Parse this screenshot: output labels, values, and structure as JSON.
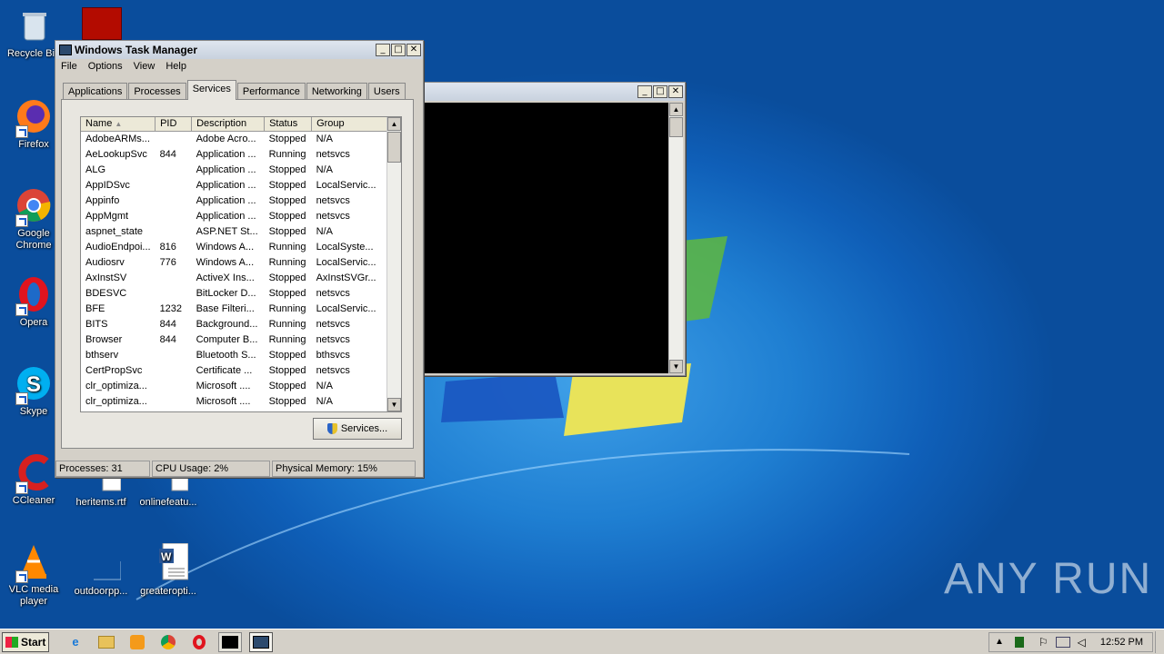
{
  "desktop": {
    "icons": [
      {
        "label": "Recycle Bin",
        "name": "recycle-bin-icon"
      },
      {
        "label": "Firefox",
        "name": "firefox-icon"
      },
      {
        "label": "Google Chrome",
        "name": "chrome-icon"
      },
      {
        "label": "Opera",
        "name": "opera-icon"
      },
      {
        "label": "Skype",
        "name": "skype-icon"
      },
      {
        "label": "CCleaner",
        "name": "ccleaner-icon"
      },
      {
        "label": "VLC media player",
        "name": "vlc-icon"
      },
      {
        "label": "heritems.rtf",
        "name": "rtf-file-icon"
      },
      {
        "label": "onlinefeatu...",
        "name": "file-icon"
      },
      {
        "label": "outdoorpp...",
        "name": "file-icon"
      },
      {
        "label": "greateropti...",
        "name": "word-file-icon"
      }
    ],
    "watermark": "ANY RUN"
  },
  "task_manager": {
    "title": "Windows Task Manager",
    "menu": [
      "File",
      "Options",
      "View",
      "Help"
    ],
    "tabs": [
      "Applications",
      "Processes",
      "Services",
      "Performance",
      "Networking",
      "Users"
    ],
    "active_tab": "Services",
    "columns": [
      "Name",
      "PID",
      "Description",
      "Status",
      "Group"
    ],
    "rows": [
      [
        "AdobeARMs...",
        "",
        "Adobe Acro...",
        "Stopped",
        "N/A"
      ],
      [
        "AeLookupSvc",
        "844",
        "Application ...",
        "Running",
        "netsvcs"
      ],
      [
        "ALG",
        "",
        "Application ...",
        "Stopped",
        "N/A"
      ],
      [
        "AppIDSvc",
        "",
        "Application ...",
        "Stopped",
        "LocalServic..."
      ],
      [
        "Appinfo",
        "",
        "Application ...",
        "Stopped",
        "netsvcs"
      ],
      [
        "AppMgmt",
        "",
        "Application ...",
        "Stopped",
        "netsvcs"
      ],
      [
        "aspnet_state",
        "",
        "ASP.NET St...",
        "Stopped",
        "N/A"
      ],
      [
        "AudioEndpoi...",
        "816",
        "Windows A...",
        "Running",
        "LocalSyste..."
      ],
      [
        "Audiosrv",
        "776",
        "Windows A...",
        "Running",
        "LocalServic..."
      ],
      [
        "AxInstSV",
        "",
        "ActiveX Ins...",
        "Stopped",
        "AxInstSVGr..."
      ],
      [
        "BDESVC",
        "",
        "BitLocker D...",
        "Stopped",
        "netsvcs"
      ],
      [
        "BFE",
        "1232",
        "Base Filteri...",
        "Running",
        "LocalServic..."
      ],
      [
        "BITS",
        "844",
        "Background...",
        "Running",
        "netsvcs"
      ],
      [
        "Browser",
        "844",
        "Computer B...",
        "Running",
        "netsvcs"
      ],
      [
        "bthserv",
        "",
        "Bluetooth S...",
        "Stopped",
        "bthsvcs"
      ],
      [
        "CertPropSvc",
        "",
        "Certificate ...",
        "Stopped",
        "netsvcs"
      ],
      [
        "clr_optimiza...",
        "",
        "Microsoft ....",
        "Stopped",
        "N/A"
      ],
      [
        "clr_optimiza...",
        "",
        "Microsoft ....",
        "Stopped",
        "N/A"
      ]
    ],
    "services_button": "Services...",
    "status": {
      "processes": "Processes: 31",
      "cpu": "CPU Usage: 2%",
      "memory": "Physical Memory: 15%"
    }
  },
  "taskbar": {
    "start": "Start",
    "time": "12:52 PM"
  }
}
